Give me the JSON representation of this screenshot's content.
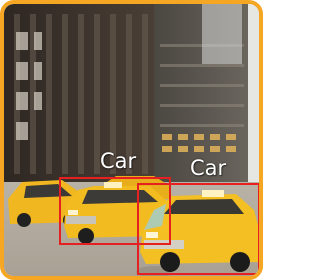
{
  "detections": [
    {
      "label": "Car"
    },
    {
      "label": "Car"
    }
  ],
  "colors": {
    "frame_border": "#f5a623",
    "bbox_stroke": "#e62020",
    "label_text": "#ffffff"
  }
}
